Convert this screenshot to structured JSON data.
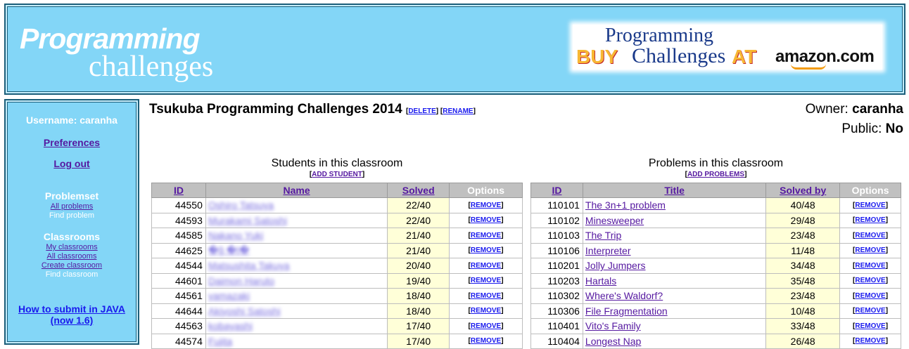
{
  "header": {
    "logo_line1": "Programming",
    "logo_line2": "challenges",
    "amazon_line1": "Programming",
    "amazon_buy": "BUY",
    "amazon_challenges": "Challenges",
    "amazon_at": "AT",
    "amazon_brand": "amazon.com"
  },
  "sidebar": {
    "username": "Username: caranha",
    "preferences": "Preferences",
    "logout": "Log out",
    "problemset_heading": "Problemset",
    "all_problems": "All problems",
    "find_problem": "Find problem",
    "classrooms_heading": "Classrooms",
    "my_classrooms": "My classrooms",
    "all_classrooms": "All classrooms",
    "create_classroom": "Create classroom",
    "find_classroom": "Find classroom",
    "java_line1": "How to submit in JAVA",
    "java_line2": "(now 1.6)"
  },
  "classroom": {
    "title": "Tsukuba Programming Challenges 2014",
    "delete": "DELETE",
    "rename": "RENAME",
    "owner_label": "Owner:",
    "owner": "caranha",
    "public_label": "Public:",
    "public": "No"
  },
  "students": {
    "caption": "Students in this classroom",
    "add": "ADD STUDENT",
    "headers": {
      "id": "ID",
      "name": "Name",
      "solved": "Solved",
      "options": "Options"
    },
    "remove_label": "REMOVE",
    "rows": [
      {
        "id": "44550",
        "name": "Oshiro Tatsuya",
        "solved": "22/40"
      },
      {
        "id": "44593",
        "name": "Murakami Satoshi",
        "solved": "22/40"
      },
      {
        "id": "44585",
        "name": "Nakano Yuki",
        "solved": "21/40"
      },
      {
        "id": "44625",
        "name": "�ǧ �Ι�",
        "solved": "21/40"
      },
      {
        "id": "44544",
        "name": "Matsushita Takuya",
        "solved": "20/40"
      },
      {
        "id": "44601",
        "name": "Daimon Haruto",
        "solved": "19/40"
      },
      {
        "id": "44561",
        "name": "yamazaki",
        "solved": "18/40"
      },
      {
        "id": "44644",
        "name": "Akiyoshi Satoshi",
        "solved": "18/40"
      },
      {
        "id": "44563",
        "name": "kobayashi",
        "solved": "17/40"
      },
      {
        "id": "44574",
        "name": "Fujita",
        "solved": "17/40"
      }
    ]
  },
  "problems": {
    "caption": "Problems in this classroom",
    "add": "ADD PROBLEMS",
    "headers": {
      "id": "ID",
      "title": "Title",
      "solved_by": "Solved by",
      "options": "Options"
    },
    "remove_label": "REMOVE",
    "rows": [
      {
        "id": "110101",
        "title": "The 3n+1 problem",
        "solved_by": "40/48"
      },
      {
        "id": "110102",
        "title": "Minesweeper",
        "solved_by": "29/48"
      },
      {
        "id": "110103",
        "title": "The Trip",
        "solved_by": "23/48"
      },
      {
        "id": "110106",
        "title": "Interpreter",
        "solved_by": "11/48"
      },
      {
        "id": "110201",
        "title": "Jolly Jumpers",
        "solved_by": "34/48"
      },
      {
        "id": "110203",
        "title": "Hartals",
        "solved_by": "35/48"
      },
      {
        "id": "110302",
        "title": "Where's Waldorf?",
        "solved_by": "23/48"
      },
      {
        "id": "110306",
        "title": "File Fragmentation",
        "solved_by": "10/48"
      },
      {
        "id": "110401",
        "title": "Vito's Family",
        "solved_by": "33/48"
      },
      {
        "id": "110404",
        "title": "Longest Nap",
        "solved_by": "26/48"
      }
    ]
  }
}
